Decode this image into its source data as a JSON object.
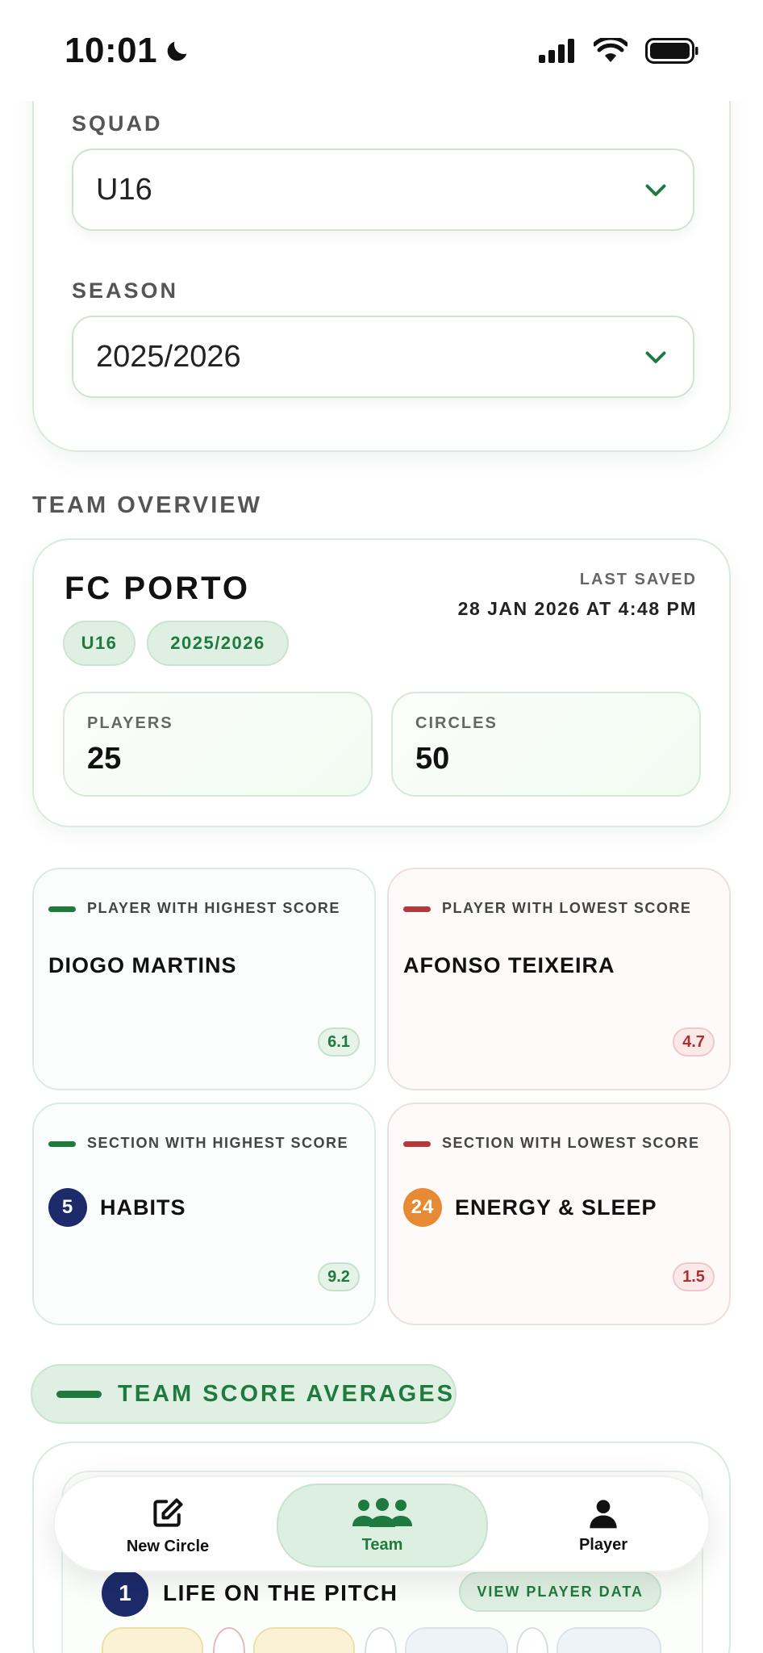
{
  "status_bar": {
    "time": "10:01"
  },
  "filters": {
    "squad_label": "SQUAD",
    "squad_value": "U16",
    "season_label": "SEASON",
    "season_value": "2025/2026"
  },
  "overview": {
    "section_title": "TEAM OVERVIEW",
    "team_name": "FC PORTO",
    "last_saved_label": "LAST SAVED",
    "last_saved_value": "28 JAN 2026 AT 4:48 PM",
    "chips": [
      "U16",
      "2025/2026"
    ],
    "players_label": "PLAYERS",
    "players_value": "25",
    "circles_label": "CIRCLES",
    "circles_value": "50"
  },
  "score_cards": {
    "highest_player": {
      "label": "PLAYER WITH HIGHEST SCORE",
      "name": "DIOGO MARTINS",
      "score": "6.1"
    },
    "lowest_player": {
      "label": "PLAYER WITH LOWEST SCORE",
      "name": "AFONSO TEIXEIRA",
      "score": "4.7"
    },
    "highest_section": {
      "label": "SECTION WITH HIGHEST SCORE",
      "number": "5",
      "name": "HABITS",
      "score": "9.2",
      "badge_color": "#1d2b6b"
    },
    "lowest_section": {
      "label": "SECTION WITH LOWEST SCORE",
      "number": "24",
      "name": "ENERGY & SLEEP",
      "score": "1.5",
      "badge_color": "#e68a35"
    }
  },
  "averages": {
    "title": "TEAM SCORE AVERAGES",
    "section_number": "1",
    "section_name": "LIFE ON THE PITCH",
    "view_button": "VIEW PLAYER DATA"
  },
  "tabs": [
    {
      "label": "New Circle",
      "icon": "edit-icon"
    },
    {
      "label": "Team",
      "icon": "team-icon",
      "active": true
    },
    {
      "label": "Player",
      "icon": "person-icon"
    }
  ],
  "colors": {
    "accent_green": "#1f7a3f",
    "accent_red": "#b23a3a",
    "chip_bg": "#dff0e2"
  }
}
